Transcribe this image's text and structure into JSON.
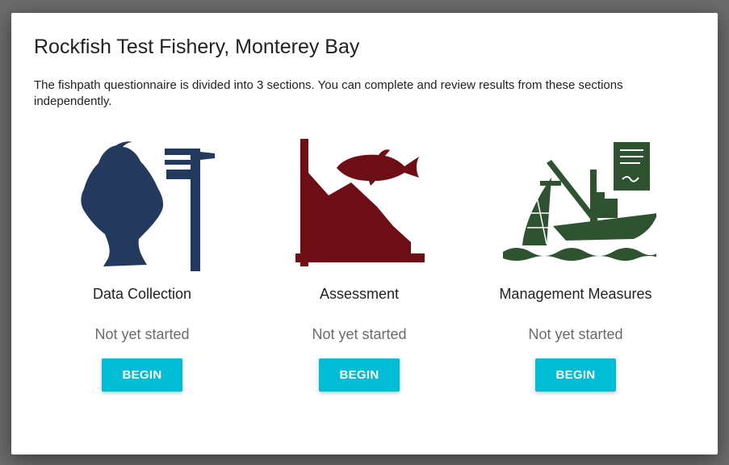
{
  "dialog": {
    "title": "Rockfish Test Fishery, Monterey Bay",
    "intro": "The fishpath questionnaire is divided into 3 sections. You can complete and review results from these sections independently."
  },
  "sections": [
    {
      "label": "Data Collection",
      "status": "Not yet started",
      "button_label": "BEGIN",
      "icon": "flatfish-caliper-icon",
      "icon_color": "#233a5e"
    },
    {
      "label": "Assessment",
      "status": "Not yet started",
      "button_label": "BEGIN",
      "icon": "fish-chart-icon",
      "icon_color": "#6e0f18"
    },
    {
      "label": "Management Measures",
      "status": "Not yet started",
      "button_label": "BEGIN",
      "icon": "fishing-boat-document-icon",
      "icon_color": "#2f5331"
    }
  ],
  "colors": {
    "accent": "#00bcd4",
    "overlay": "#6b6b6b",
    "status_text": "#6b6b6b"
  }
}
